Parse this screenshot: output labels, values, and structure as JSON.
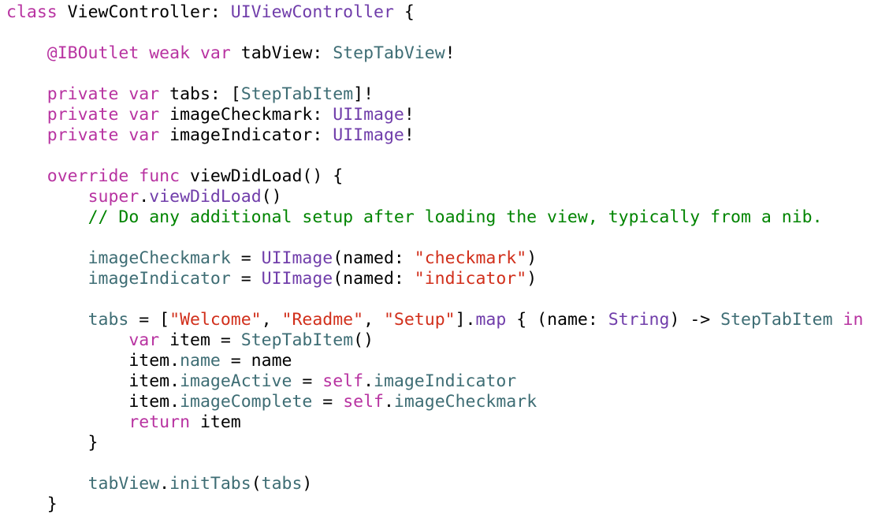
{
  "editor": {
    "language": "Swift",
    "colors": {
      "background": "#ffffff",
      "plain": "#000000",
      "keyword": "#b833a1",
      "system_type": "#703daa",
      "project_symbol": "#3e6d74",
      "string": "#d12f1b",
      "comment": "#008400"
    },
    "lines": [
      [
        {
          "t": "class",
          "c": "kw"
        },
        {
          "t": " ViewController: ",
          "c": "plain"
        },
        {
          "t": "UIViewController",
          "c": "type"
        },
        {
          "t": " {",
          "c": "plain"
        }
      ],
      [],
      [
        {
          "t": "    ",
          "c": "plain"
        },
        {
          "t": "@IBOutlet",
          "c": "kw"
        },
        {
          "t": " ",
          "c": "plain"
        },
        {
          "t": "weak",
          "c": "kw"
        },
        {
          "t": " ",
          "c": "plain"
        },
        {
          "t": "var",
          "c": "kw"
        },
        {
          "t": " tabView: ",
          "c": "plain"
        },
        {
          "t": "StepTabView",
          "c": "proj"
        },
        {
          "t": "!",
          "c": "plain"
        }
      ],
      [],
      [
        {
          "t": "    ",
          "c": "plain"
        },
        {
          "t": "private",
          "c": "kw"
        },
        {
          "t": " ",
          "c": "plain"
        },
        {
          "t": "var",
          "c": "kw"
        },
        {
          "t": " tabs: [",
          "c": "plain"
        },
        {
          "t": "StepTabItem",
          "c": "proj"
        },
        {
          "t": "]!",
          "c": "plain"
        }
      ],
      [
        {
          "t": "    ",
          "c": "plain"
        },
        {
          "t": "private",
          "c": "kw"
        },
        {
          "t": " ",
          "c": "plain"
        },
        {
          "t": "var",
          "c": "kw"
        },
        {
          "t": " imageCheckmark: ",
          "c": "plain"
        },
        {
          "t": "UIImage",
          "c": "type"
        },
        {
          "t": "!",
          "c": "plain"
        }
      ],
      [
        {
          "t": "    ",
          "c": "plain"
        },
        {
          "t": "private",
          "c": "kw"
        },
        {
          "t": " ",
          "c": "plain"
        },
        {
          "t": "var",
          "c": "kw"
        },
        {
          "t": " imageIndicator: ",
          "c": "plain"
        },
        {
          "t": "UIImage",
          "c": "type"
        },
        {
          "t": "!",
          "c": "plain"
        }
      ],
      [],
      [
        {
          "t": "    ",
          "c": "plain"
        },
        {
          "t": "override",
          "c": "kw"
        },
        {
          "t": " ",
          "c": "plain"
        },
        {
          "t": "func",
          "c": "kw"
        },
        {
          "t": " viewDidLoad() {",
          "c": "plain"
        }
      ],
      [
        {
          "t": "        ",
          "c": "plain"
        },
        {
          "t": "super",
          "c": "kw"
        },
        {
          "t": ".",
          "c": "plain"
        },
        {
          "t": "viewDidLoad",
          "c": "type"
        },
        {
          "t": "()",
          "c": "plain"
        }
      ],
      [
        {
          "t": "        ",
          "c": "plain"
        },
        {
          "t": "// Do any additional setup after loading the view, typically from a nib.",
          "c": "cmt"
        }
      ],
      [],
      [
        {
          "t": "        ",
          "c": "plain"
        },
        {
          "t": "imageCheckmark",
          "c": "proj"
        },
        {
          "t": " = ",
          "c": "plain"
        },
        {
          "t": "UIImage",
          "c": "type"
        },
        {
          "t": "(named: ",
          "c": "plain"
        },
        {
          "t": "\"checkmark\"",
          "c": "str"
        },
        {
          "t": ")",
          "c": "plain"
        }
      ],
      [
        {
          "t": "        ",
          "c": "plain"
        },
        {
          "t": "imageIndicator",
          "c": "proj"
        },
        {
          "t": " = ",
          "c": "plain"
        },
        {
          "t": "UIImage",
          "c": "type"
        },
        {
          "t": "(named: ",
          "c": "plain"
        },
        {
          "t": "\"indicator\"",
          "c": "str"
        },
        {
          "t": ")",
          "c": "plain"
        }
      ],
      [],
      [
        {
          "t": "        ",
          "c": "plain"
        },
        {
          "t": "tabs",
          "c": "proj"
        },
        {
          "t": " = [",
          "c": "plain"
        },
        {
          "t": "\"Welcome\"",
          "c": "str"
        },
        {
          "t": ", ",
          "c": "plain"
        },
        {
          "t": "\"Readme\"",
          "c": "str"
        },
        {
          "t": ", ",
          "c": "plain"
        },
        {
          "t": "\"Setup\"",
          "c": "str"
        },
        {
          "t": "].",
          "c": "plain"
        },
        {
          "t": "map",
          "c": "type"
        },
        {
          "t": " { (name: ",
          "c": "plain"
        },
        {
          "t": "String",
          "c": "type"
        },
        {
          "t": ") -> ",
          "c": "plain"
        },
        {
          "t": "StepTabItem",
          "c": "proj"
        },
        {
          "t": " ",
          "c": "plain"
        },
        {
          "t": "in",
          "c": "kw"
        }
      ],
      [
        {
          "t": "            ",
          "c": "plain"
        },
        {
          "t": "var",
          "c": "kw"
        },
        {
          "t": " item = ",
          "c": "plain"
        },
        {
          "t": "StepTabItem",
          "c": "proj"
        },
        {
          "t": "()",
          "c": "plain"
        }
      ],
      [
        {
          "t": "            item.",
          "c": "plain"
        },
        {
          "t": "name",
          "c": "proj"
        },
        {
          "t": " = name",
          "c": "plain"
        }
      ],
      [
        {
          "t": "            item.",
          "c": "plain"
        },
        {
          "t": "imageActive",
          "c": "proj"
        },
        {
          "t": " = ",
          "c": "plain"
        },
        {
          "t": "self",
          "c": "kw"
        },
        {
          "t": ".",
          "c": "plain"
        },
        {
          "t": "imageIndicator",
          "c": "proj"
        }
      ],
      [
        {
          "t": "            item.",
          "c": "plain"
        },
        {
          "t": "imageComplete",
          "c": "proj"
        },
        {
          "t": " = ",
          "c": "plain"
        },
        {
          "t": "self",
          "c": "kw"
        },
        {
          "t": ".",
          "c": "plain"
        },
        {
          "t": "imageCheckmark",
          "c": "proj"
        }
      ],
      [
        {
          "t": "            ",
          "c": "plain"
        },
        {
          "t": "return",
          "c": "kw"
        },
        {
          "t": " item",
          "c": "plain"
        }
      ],
      [
        {
          "t": "        }",
          "c": "plain"
        }
      ],
      [],
      [
        {
          "t": "        ",
          "c": "plain"
        },
        {
          "t": "tabView",
          "c": "proj"
        },
        {
          "t": ".",
          "c": "plain"
        },
        {
          "t": "initTabs",
          "c": "proj"
        },
        {
          "t": "(",
          "c": "plain"
        },
        {
          "t": "tabs",
          "c": "proj"
        },
        {
          "t": ")",
          "c": "plain"
        }
      ],
      [
        {
          "t": "    }",
          "c": "plain"
        }
      ]
    ]
  }
}
